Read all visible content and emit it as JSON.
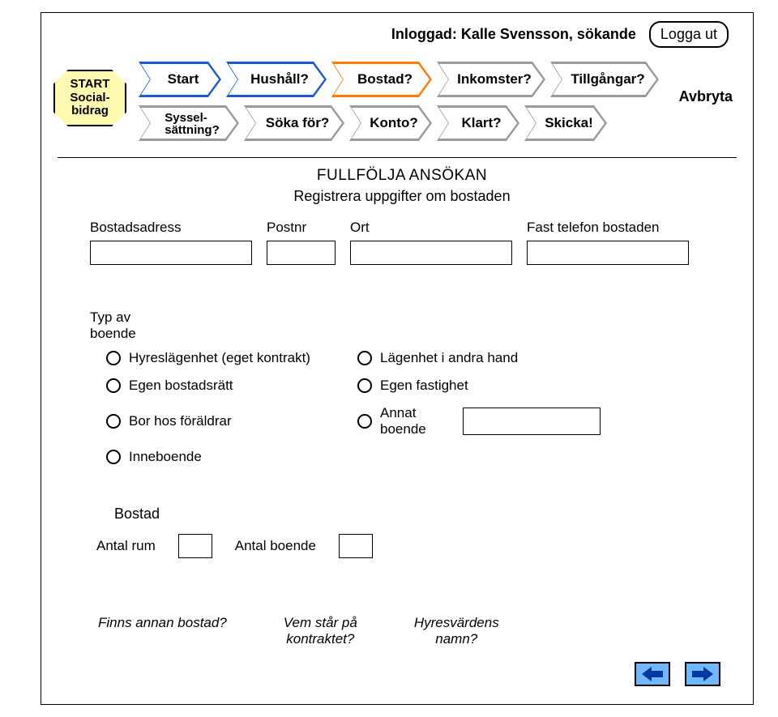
{
  "header": {
    "login_prefix": "Inloggad: ",
    "user_name": "Kalle Svensson, sökande",
    "logout_label": "Logga ut"
  },
  "start_badge": "START\nSocial-\nbidrag",
  "steps_row1": [
    {
      "label": "Start",
      "style": "blue"
    },
    {
      "label": "Hushåll?",
      "style": "blue"
    },
    {
      "label": "Bostad?",
      "style": "orange"
    },
    {
      "label": "Inkomster?",
      "style": "gray"
    },
    {
      "label": "Tillgångar?",
      "style": "gray"
    }
  ],
  "steps_row2": [
    {
      "label": "Syssel-\nsättning?",
      "style": "gray"
    },
    {
      "label": "Söka för?",
      "style": "gray"
    },
    {
      "label": "Konto?",
      "style": "gray"
    },
    {
      "label": "Klart?",
      "style": "gray"
    },
    {
      "label": "Skicka!",
      "style": "gray"
    }
  ],
  "cancel_label": "Avbryta",
  "form": {
    "title": "FULLFÖLJA ANSÖKAN",
    "subtitle": "Registrera uppgifter om bostaden",
    "address_label": "Bostadsadress",
    "postcode_label": "Postnr",
    "city_label": "Ort",
    "phone_label": "Fast telefon bostaden"
  },
  "housing_type": {
    "section_label": "Typ av\nboende",
    "options": {
      "opt1": "Hyreslägenhet (eget kontrakt)",
      "opt2": "Lägenhet i andra hand",
      "opt3": "Egen bostadsrätt",
      "opt4": "Egen fastighet",
      "opt5": "Bor hos föräldrar",
      "opt6": "Annat boende",
      "opt7": "Inneboende"
    }
  },
  "dwelling": {
    "header": "Bostad",
    "rooms_label": "Antal rum",
    "residents_label": "Antal boende"
  },
  "questions": {
    "q1": "Finns annan bostad?",
    "q2": "Vem står på\nkontraktet?",
    "q3": "Hyresvärdens\nnamn?"
  }
}
